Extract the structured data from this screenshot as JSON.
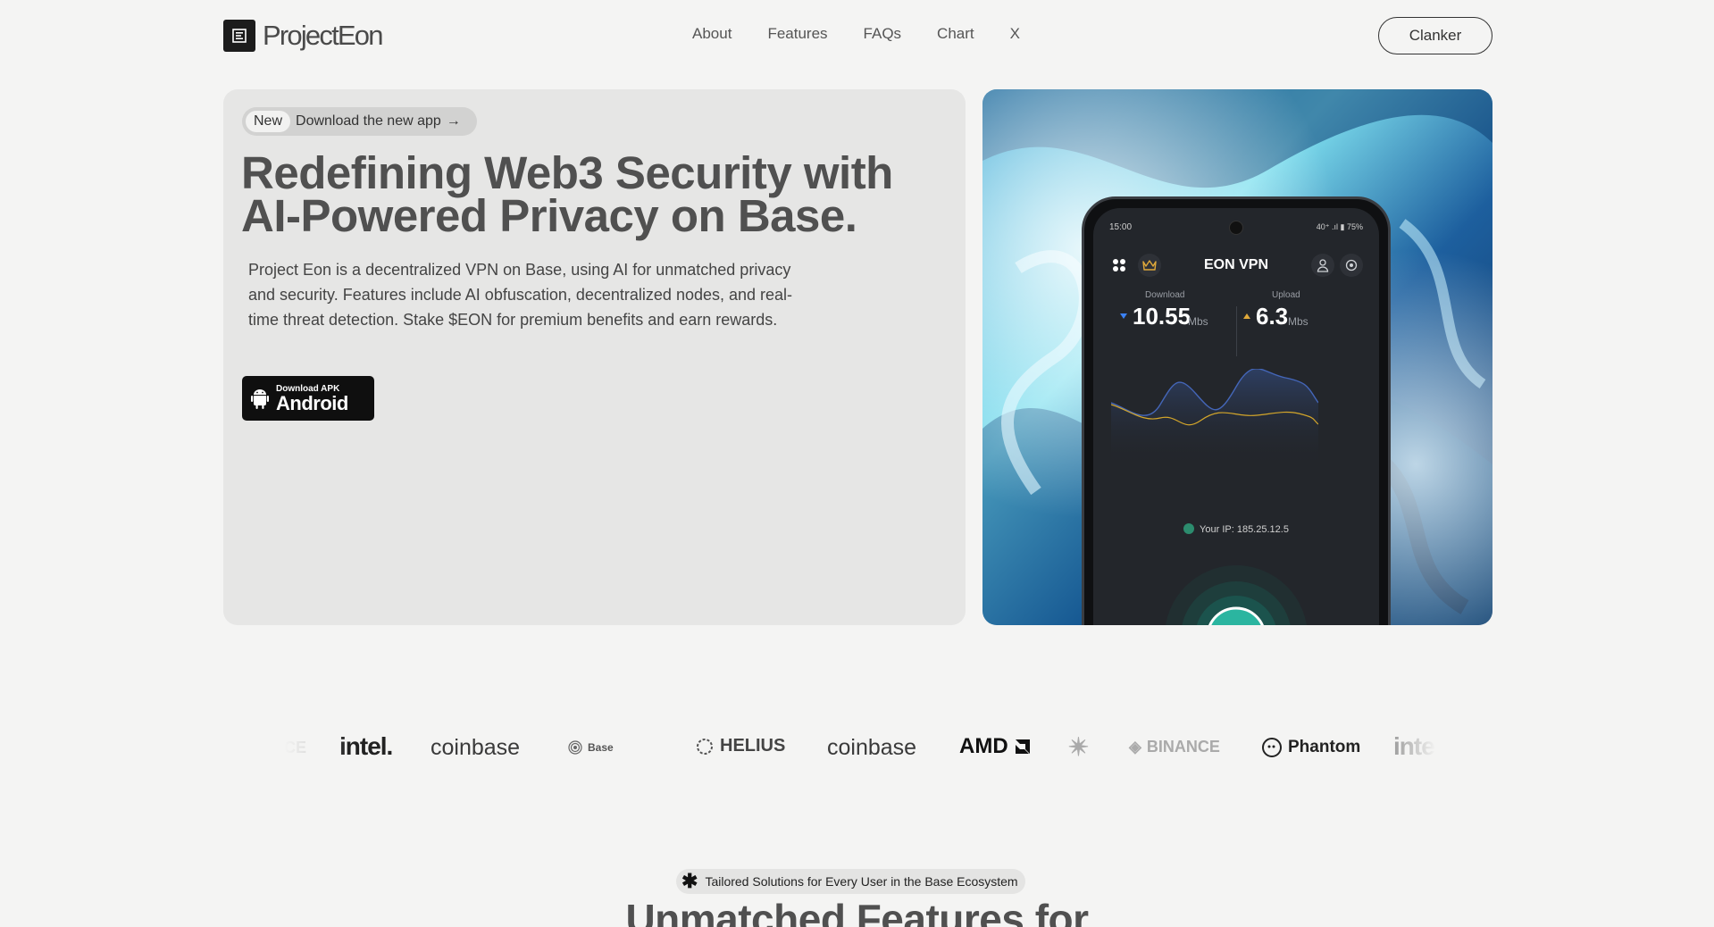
{
  "nav": {
    "logo_text": "ProjectEon",
    "links": [
      "About",
      "Features",
      "FAQs",
      "Chart",
      "X"
    ],
    "cta_label": "Clanker"
  },
  "hero": {
    "pill_badge": "New",
    "pill_text": "Download the new app",
    "title": "Redefining Web3 Security with AI-Powered Privacy on Base.",
    "description": "Project Eon is a decentralized VPN on Base, using AI for unmatched privacy and security. Features include AI obfuscation, decentralized nodes, and real-time threat detection. Stake $EON for premium benefits and earn rewards.",
    "download_small": "Download APK",
    "download_big": "Android"
  },
  "phone": {
    "time": "15:00",
    "status": "40⁺ .ıl ▮ 75%",
    "app_title": "EON VPN",
    "download_label": "Download",
    "download_value": "10.55",
    "download_unit": "Mbs",
    "upload_label": "Upload",
    "upload_value": "6.3",
    "upload_unit": "Mbs",
    "ip_text": "Your IP: 185.25.12.5"
  },
  "partners": [
    "CE",
    "intel.",
    "coinbase",
    "Base",
    "HELIUS",
    "coinbase",
    "AMD",
    "BINANCE",
    "Phantom",
    "inte"
  ],
  "features": {
    "tag_text": "Tailored Solutions for Every User in the Base Ecosystem",
    "heading": "Unmatched Features for"
  },
  "colors": {
    "accent_teal": "#2bb5a0",
    "chart_blue": "#3b5ea8",
    "chart_yellow": "#d4a62a",
    "cta_border": "#333333"
  }
}
